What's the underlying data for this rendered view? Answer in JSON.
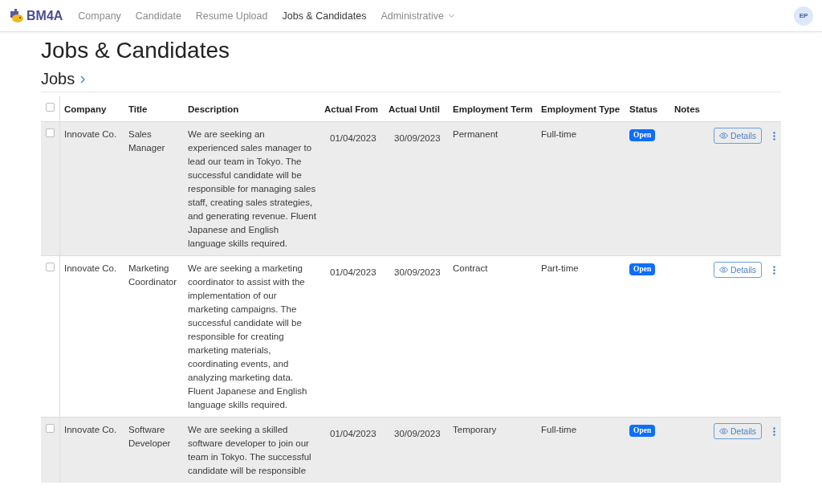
{
  "navbar": {
    "brand": "BM4A",
    "items": [
      {
        "label": "Company",
        "selected": false,
        "kind": "link"
      },
      {
        "label": "Candidate",
        "selected": false,
        "kind": "link"
      },
      {
        "label": "Resume Upload",
        "selected": false,
        "kind": "link"
      },
      {
        "label": "Jobs & Candidates",
        "selected": true,
        "kind": "link"
      },
      {
        "label": "Administrative",
        "selected": false,
        "kind": "dropdown"
      }
    ],
    "avatar": "EP"
  },
  "page": {
    "title": "Jobs & Candidates",
    "section": "Jobs"
  },
  "table": {
    "header_checked": false,
    "columns": [
      "Company",
      "Title",
      "Description",
      "Actual From",
      "Actual Until",
      "Employment Term",
      "Employment Type",
      "Status",
      "Notes"
    ],
    "rows": [
      {
        "checked": false,
        "company": "Innovate Co.",
        "title": "Sales Manager",
        "description": "We are seeking an experienced sales manager to lead our team in Tokyo. The successful candidate will be responsible for managing sales staff, creating sales strategies, and generating revenue. Fluent Japanese and English language skills required.",
        "actual_from": "01/04/2023",
        "actual_until": "30/09/2023",
        "employment_term": "Permanent",
        "employment_type": "Full-time",
        "status": "Open",
        "action": "Details"
      },
      {
        "checked": false,
        "company": "Innovate Co.",
        "title": "Marketing Coordinator",
        "description": "We are seeking a marketing coordinator to assist with the implementation of our marketing campaigns. The successful candidate will be responsible for creating marketing materials, coordinating events, and analyzing marketing data. Fluent Japanese and English language skills required.",
        "actual_from": "01/04/2023",
        "actual_until": "30/09/2023",
        "employment_term": "Contract",
        "employment_type": "Part-time",
        "status": "Open",
        "action": "Details"
      },
      {
        "checked": false,
        "company": "Innovate Co.",
        "title": "Software Developer",
        "description": "We are seeking a skilled software developer to join our team in Tokyo. The successful candidate will be responsible",
        "actual_from": "01/04/2023",
        "actual_until": "30/09/2023",
        "employment_term": "Temporary",
        "employment_type": "Full-time",
        "status": "Open",
        "action": "Details"
      }
    ]
  }
}
